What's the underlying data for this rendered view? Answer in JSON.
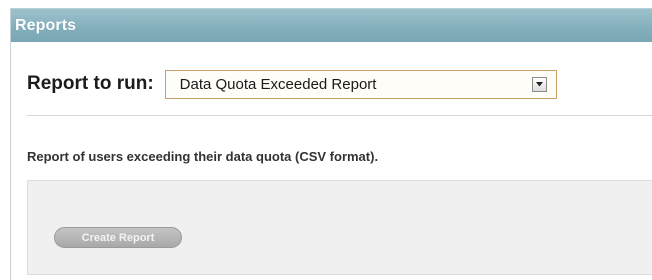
{
  "panel": {
    "title": "Reports"
  },
  "report_selector": {
    "label": "Report to run:",
    "selected": "Data Quota Exceeded Report",
    "arrow_icon": "chevron-down-icon"
  },
  "report": {
    "description": "Report of users exceeding their data quota (CSV format).",
    "create_button_label": "Create Report",
    "create_button_state": "disabled"
  },
  "colors": {
    "header_bg": "#84b0bd",
    "header_text": "#ffffff",
    "select_border": "#c8a068",
    "button_bg": "#b3b3b3"
  }
}
